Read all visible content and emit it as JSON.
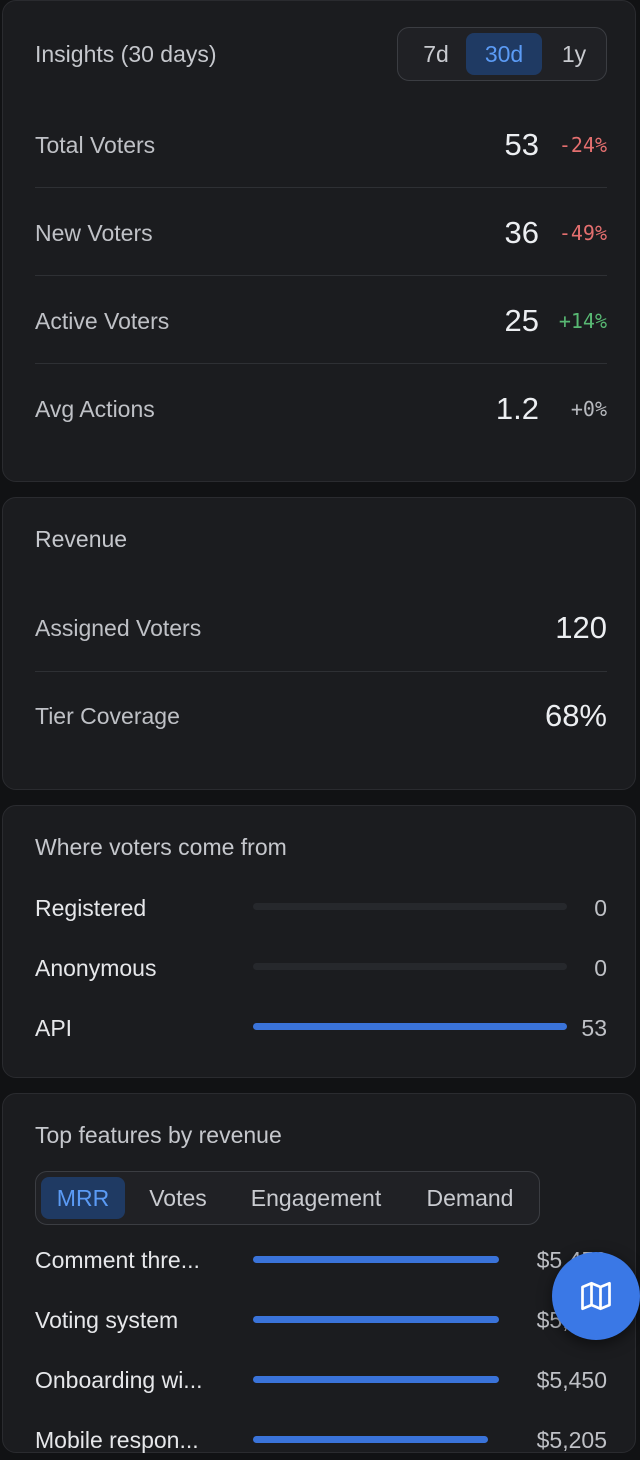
{
  "insights": {
    "title": "Insights (30 days)",
    "periods": [
      "7d",
      "30d",
      "1y"
    ],
    "selected_period": "30d",
    "metrics": [
      {
        "label": "Total Voters",
        "value": "53",
        "change": "-24%"
      },
      {
        "label": "New Voters",
        "value": "36",
        "change": "-49%"
      },
      {
        "label": "Active Voters",
        "value": "25",
        "change": "+14%"
      },
      {
        "label": "Avg Actions",
        "value": "1.2",
        "change": "+0%"
      }
    ]
  },
  "revenue": {
    "title": "Revenue",
    "metrics": [
      {
        "label": "Assigned Voters",
        "value": "120"
      },
      {
        "label": "Tier Coverage",
        "value": "68%"
      }
    ]
  },
  "sources": {
    "title": "Where voters come from",
    "items": [
      {
        "label": "Registered",
        "count": "0",
        "fraction": 0
      },
      {
        "label": "Anonymous",
        "count": "0",
        "fraction": 0
      },
      {
        "label": "API",
        "count": "53",
        "fraction": 1
      }
    ]
  },
  "top_features": {
    "title": "Top features by revenue",
    "tabs": [
      "MRR",
      "Votes",
      "Engagement",
      "Demand"
    ],
    "selected_tab": "MRR",
    "items": [
      {
        "label": "Comment thre...",
        "value": "$5,450",
        "fraction": 1
      },
      {
        "label": "Voting system",
        "value": "$5,450",
        "fraction": 1
      },
      {
        "label": "Onboarding wi...",
        "value": "$5,450",
        "fraction": 1
      },
      {
        "label": "Mobile respon...",
        "value": "$5,205",
        "fraction": 0.955
      }
    ]
  },
  "colors": {
    "accent": "#3a78e6",
    "negative": "#e46f6f",
    "positive": "#58b873"
  },
  "fab": {
    "icon": "map-icon"
  }
}
